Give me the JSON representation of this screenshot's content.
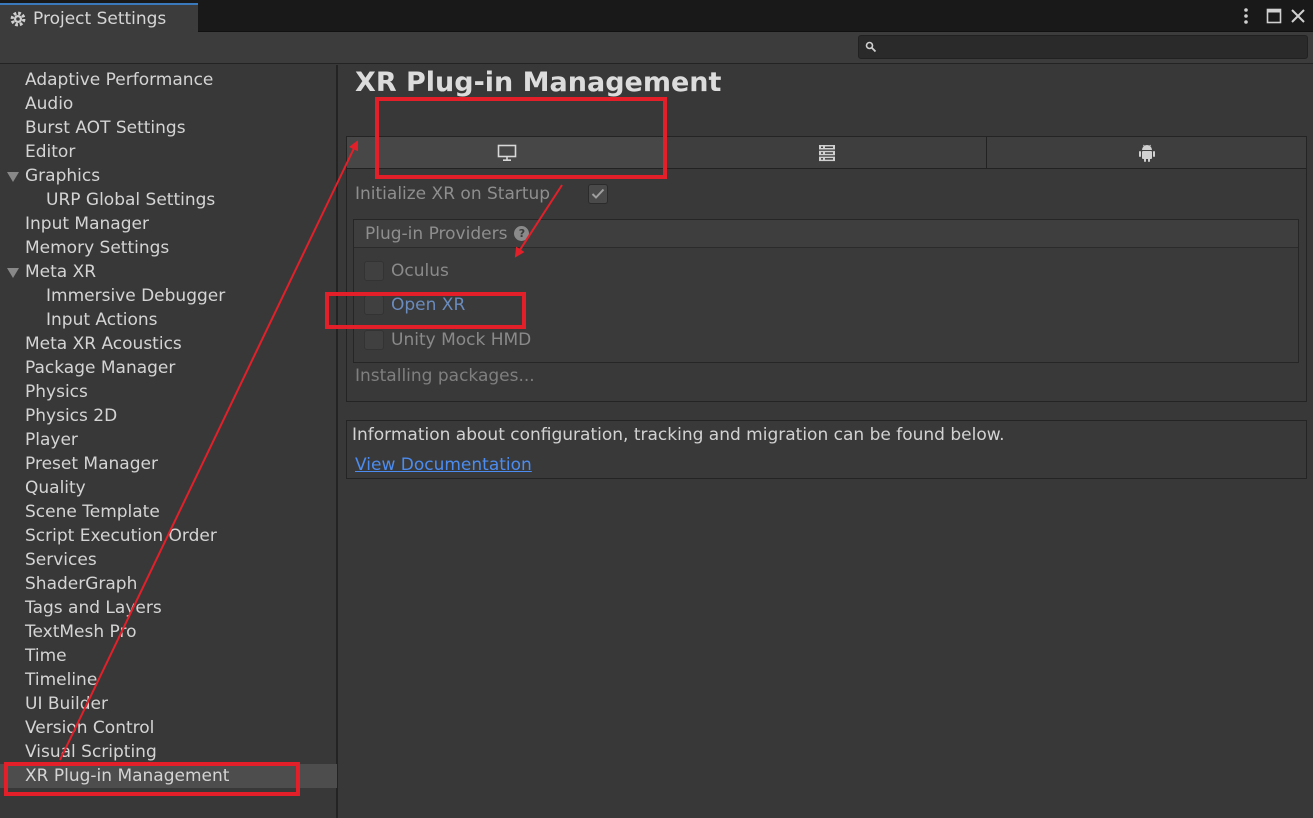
{
  "window": {
    "tab_title": "Project Settings",
    "search": {
      "placeholder": "",
      "value": ""
    }
  },
  "sidebar": {
    "items": [
      {
        "label": "Adaptive Performance",
        "indent": 0,
        "expander": false,
        "selected": false
      },
      {
        "label": "Audio",
        "indent": 0,
        "expander": false,
        "selected": false
      },
      {
        "label": "Burst AOT Settings",
        "indent": 0,
        "expander": false,
        "selected": false
      },
      {
        "label": "Editor",
        "indent": 0,
        "expander": false,
        "selected": false
      },
      {
        "label": "Graphics",
        "indent": 0,
        "expander": true,
        "selected": false
      },
      {
        "label": "URP Global Settings",
        "indent": 1,
        "expander": false,
        "selected": false
      },
      {
        "label": "Input Manager",
        "indent": 0,
        "expander": false,
        "selected": false
      },
      {
        "label": "Memory Settings",
        "indent": 0,
        "expander": false,
        "selected": false
      },
      {
        "label": "Meta XR",
        "indent": 0,
        "expander": true,
        "selected": false
      },
      {
        "label": "Immersive Debugger",
        "indent": 1,
        "expander": false,
        "selected": false
      },
      {
        "label": "Input Actions",
        "indent": 1,
        "expander": false,
        "selected": false
      },
      {
        "label": "Meta XR Acoustics",
        "indent": 0,
        "expander": false,
        "selected": false
      },
      {
        "label": "Package Manager",
        "indent": 0,
        "expander": false,
        "selected": false
      },
      {
        "label": "Physics",
        "indent": 0,
        "expander": false,
        "selected": false
      },
      {
        "label": "Physics 2D",
        "indent": 0,
        "expander": false,
        "selected": false
      },
      {
        "label": "Player",
        "indent": 0,
        "expander": false,
        "selected": false
      },
      {
        "label": "Preset Manager",
        "indent": 0,
        "expander": false,
        "selected": false
      },
      {
        "label": "Quality",
        "indent": 0,
        "expander": false,
        "selected": false
      },
      {
        "label": "Scene Template",
        "indent": 0,
        "expander": false,
        "selected": false
      },
      {
        "label": "Script Execution Order",
        "indent": 0,
        "expander": false,
        "selected": false
      },
      {
        "label": "Services",
        "indent": 0,
        "expander": false,
        "selected": false
      },
      {
        "label": "ShaderGraph",
        "indent": 0,
        "expander": false,
        "selected": false
      },
      {
        "label": "Tags and Layers",
        "indent": 0,
        "expander": false,
        "selected": false
      },
      {
        "label": "TextMesh Pro",
        "indent": 0,
        "expander": false,
        "selected": false
      },
      {
        "label": "Time",
        "indent": 0,
        "expander": false,
        "selected": false
      },
      {
        "label": "Timeline",
        "indent": 0,
        "expander": false,
        "selected": false
      },
      {
        "label": "UI Builder",
        "indent": 0,
        "expander": false,
        "selected": false
      },
      {
        "label": "Version Control",
        "indent": 0,
        "expander": false,
        "selected": false
      },
      {
        "label": "Visual Scripting",
        "indent": 0,
        "expander": false,
        "selected": false
      },
      {
        "label": "XR Plug-in Management",
        "indent": 0,
        "expander": false,
        "selected": true
      }
    ]
  },
  "main": {
    "title": "XR Plug-in Management",
    "platform_tabs": [
      {
        "icon": "desktop-monitor-icon",
        "active": true
      },
      {
        "icon": "server-icon",
        "active": false
      },
      {
        "icon": "android-icon",
        "active": false
      }
    ],
    "init_label": "Initialize XR on Startup",
    "init_checked": true,
    "providers_header": "Plug-in Providers",
    "providers": [
      {
        "label": "Oculus",
        "checked": false,
        "link": false
      },
      {
        "label": "Open XR",
        "checked": false,
        "link": true
      },
      {
        "label": "Unity Mock HMD",
        "checked": false,
        "link": false
      }
    ],
    "status": "Installing packages...",
    "info_text": "Information about configuration, tracking and migration can be found below.",
    "doc_link": "View Documentation"
  },
  "colors": {
    "annotation": "#e3202a",
    "link": "#4c8cf0",
    "tab_accent": "#3a79bb",
    "selection": "#4d4d4d"
  }
}
